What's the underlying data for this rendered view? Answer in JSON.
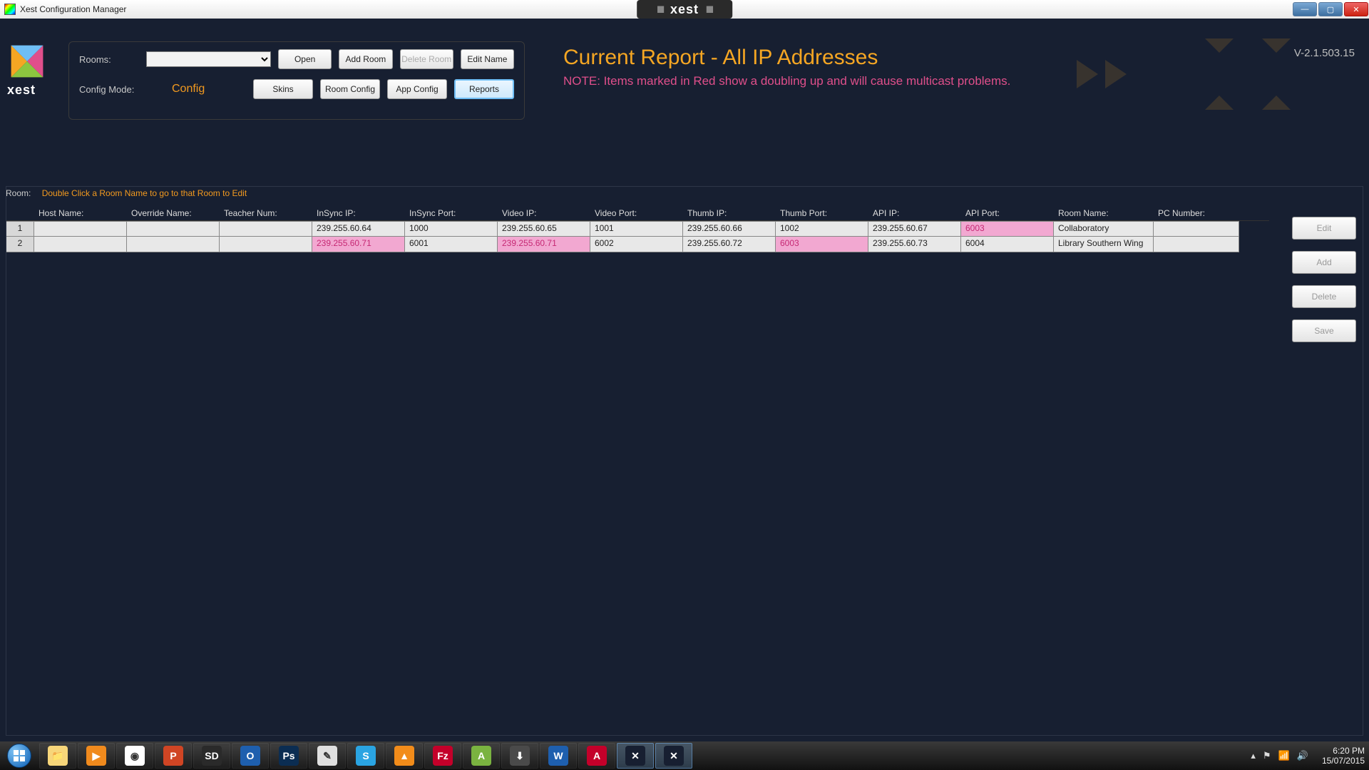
{
  "window": {
    "title": "Xest Configuration Manager",
    "brand": "xest"
  },
  "header": {
    "rooms_label": "Rooms:",
    "rooms_value": "",
    "config_mode_label": "Config Mode:",
    "config_mode_value": "Config",
    "buttons": {
      "open": "Open",
      "add_room": "Add Room",
      "delete_room": "Delete Room",
      "edit_name": "Edit Name",
      "skins": "Skins",
      "room_config": "Room Config",
      "app_config": "App Config",
      "reports": "Reports"
    },
    "report_title": "Current Report - All IP Addresses",
    "report_note": "NOTE: Items marked in Red show a doubling up and will cause multicast problems.",
    "version": "V-2.1.503.15",
    "brand_text": "xest"
  },
  "table": {
    "note_label": "Room:",
    "note_text": "Double Click a Room Name to go to that Room to Edit",
    "columns": [
      "Host Name:",
      "Override Name:",
      "Teacher Num:",
      "InSync IP:",
      "InSync Port:",
      "Video IP:",
      "Video Port:",
      "Thumb IP:",
      "Thumb Port:",
      "API IP:",
      "API Port:",
      "Room Name:",
      "PC Number:"
    ],
    "rows": [
      {
        "idx": "1",
        "cells": [
          "",
          "",
          "",
          "239.255.60.64",
          "1000",
          "239.255.60.65",
          "1001",
          "239.255.60.66",
          "1002",
          "239.255.60.67",
          "6003",
          "Collaboratory",
          ""
        ],
        "highlight": [
          10
        ]
      },
      {
        "idx": "2",
        "cells": [
          "",
          "",
          "",
          "239.255.60.71",
          "6001",
          "239.255.60.71",
          "6002",
          "239.255.60.72",
          "6003",
          "239.255.60.73",
          "6004",
          "Library Southern Wing",
          ""
        ],
        "highlight": [
          3,
          5,
          8
        ]
      }
    ],
    "side_buttons": {
      "edit": "Edit",
      "add": "Add",
      "delete": "Delete",
      "save": "Save"
    }
  },
  "taskbar": {
    "items": [
      {
        "name": "explorer",
        "bg": "#f7d67a",
        "txt": "📁"
      },
      {
        "name": "mediaplayer",
        "bg": "#f08a1d",
        "txt": "▶"
      },
      {
        "name": "chrome",
        "bg": "#ffffff",
        "txt": "◉"
      },
      {
        "name": "powerpoint",
        "bg": "#d04524",
        "txt": "P"
      },
      {
        "name": "sd",
        "bg": "#2a2a2a",
        "txt": "SD"
      },
      {
        "name": "outlook",
        "bg": "#1e5fae",
        "txt": "O"
      },
      {
        "name": "photoshop",
        "bg": "#0b2d52",
        "txt": "Ps"
      },
      {
        "name": "notepad",
        "bg": "#e0e0e0",
        "txt": "✎"
      },
      {
        "name": "skype",
        "bg": "#2aa4e2",
        "txt": "S"
      },
      {
        "name": "vlc",
        "bg": "#f28c1a",
        "txt": "▲"
      },
      {
        "name": "filezilla",
        "bg": "#c4002a",
        "txt": "Fz"
      },
      {
        "name": "androidstudio",
        "bg": "#7ab340",
        "txt": "A"
      },
      {
        "name": "download",
        "bg": "#4a4a4a",
        "txt": "⬇"
      },
      {
        "name": "word",
        "bg": "#1e5fae",
        "txt": "W"
      },
      {
        "name": "acrobat",
        "bg": "#c4002a",
        "txt": "A"
      },
      {
        "name": "xest1",
        "bg": "#171f31",
        "txt": "✕"
      },
      {
        "name": "xest2",
        "bg": "#171f31",
        "txt": "✕"
      }
    ],
    "active_indices": [
      15,
      16
    ],
    "clock_time": "6:20 PM",
    "clock_date": "15/07/2015"
  }
}
